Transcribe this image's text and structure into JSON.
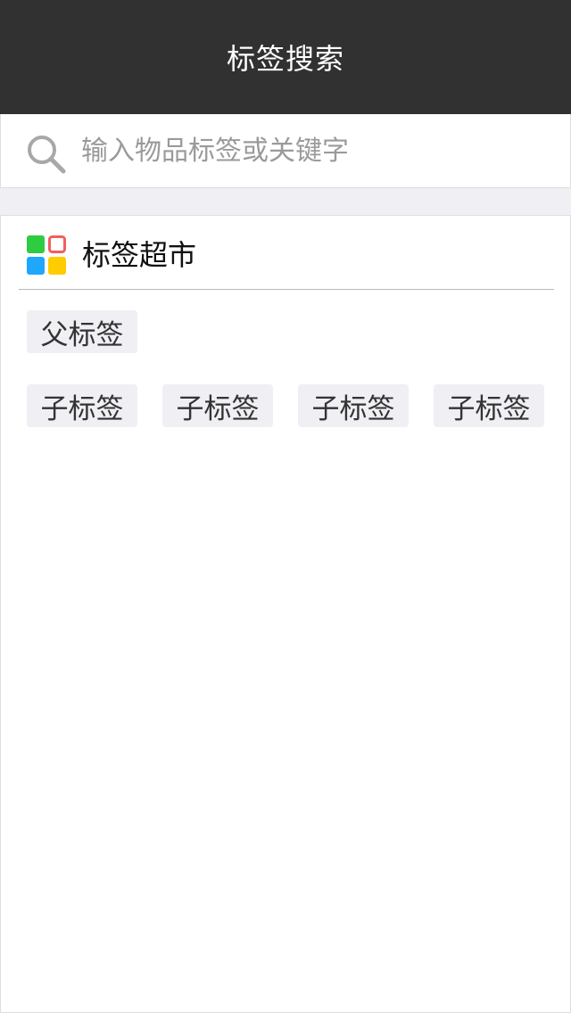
{
  "header": {
    "title": "标签搜索"
  },
  "search": {
    "placeholder": "输入物品标签或关键字",
    "value": ""
  },
  "section": {
    "title": "标签超市",
    "icon": "grid-icon",
    "icon_colors": [
      "#2ecc40",
      "#f25f5c",
      "#1ea7fd",
      "#ffcc00"
    ]
  },
  "tags": {
    "parent": "父标签",
    "children": [
      "子标签",
      "子标签",
      "子标签",
      "子标签"
    ]
  },
  "colors": {
    "nav_bg": "#313131",
    "page_bg": "#efeff4",
    "tag_bg": "#efeff4"
  }
}
